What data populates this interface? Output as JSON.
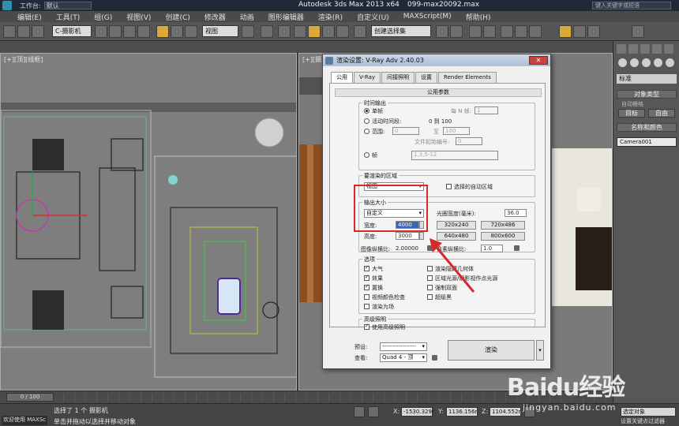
{
  "titlebar": {
    "workspace_label": "工作台:",
    "workspace_value": "默认",
    "app_title": "Autodesk 3ds Max  2013 x64",
    "file_name": "099-max20092.max",
    "search_placeholder": "键入关键字或短语"
  },
  "menu": [
    "编辑(E)",
    "工具(T)",
    "组(G)",
    "视图(V)",
    "创建(C)",
    "修改器",
    "动画",
    "图形编辑器",
    "渲染(R)",
    "自定义(U)",
    "MAXScript(M)",
    "帮助(H)"
  ],
  "toolbar": {
    "camera_dropdown": "C-摄影机",
    "view_dropdown": "视图",
    "selection_set": "创建选择集"
  },
  "viewports": {
    "left_label": "[+][顶][线框]",
    "right_label": "[+][摄影机][真实]"
  },
  "command_panel": {
    "standard": "标准",
    "object_type": "对象类型",
    "auto_grid": "自动栅格",
    "target_btn": "目标",
    "free_btn": "自由",
    "name_color": "名称和颜色",
    "camera_name": "Camera001"
  },
  "dialog": {
    "title": "渲染设置: V-Ray Adv 2.40.03",
    "close": "✕",
    "tabs": [
      "公用",
      "V-Ray",
      "间接照明",
      "设置",
      "Render Elements"
    ],
    "common_params": "公用参数",
    "time_output": {
      "title": "时间输出",
      "single": "单帧",
      "every_n_label": "每 N 帧:",
      "every_n_value": "1",
      "active_segment": "活动时间段:",
      "active_range": "0 到 100",
      "range": "范围:",
      "range_from": "0",
      "range_to_label": "至",
      "range_to": "100",
      "file_start_label": "文件起始编号:",
      "file_start": "0",
      "frames": "帧",
      "frames_value": "1,3,5-12"
    },
    "area": {
      "title": "要渲染的区域",
      "value": "视图",
      "auto_region": "选择的自动区域"
    },
    "output_size": {
      "title": "输出大小",
      "preset": "自定义",
      "aperture_label": "光圈宽度(毫米):",
      "aperture_value": "36.0",
      "width_label": "宽度:",
      "width_value": "4000",
      "height_label": "高度:",
      "height_value": "3000",
      "presets": [
        "320x240",
        "720x486",
        "640x480",
        "800x600"
      ],
      "image_aspect_label": "图像纵横比:",
      "image_aspect_value": "2.00000",
      "pixel_aspect_label": "像素纵横比:",
      "pixel_aspect_value": "1.0"
    },
    "options": {
      "title": "选项",
      "left": [
        {
          "label": "大气",
          "on": true
        },
        {
          "label": "效果",
          "on": true
        },
        {
          "label": "置换",
          "on": true
        },
        {
          "label": "视频颜色检查",
          "on": false
        },
        {
          "label": "渲染为场",
          "on": false
        }
      ],
      "right": [
        {
          "label": "渲染隐藏几何体",
          "on": false
        },
        {
          "label": "区域光源/阴影视作点光源",
          "on": false
        },
        {
          "label": "强制双面",
          "on": false
        },
        {
          "label": "超级黑",
          "on": false
        }
      ]
    },
    "advanced_lighting": {
      "title": "高级照明",
      "use": "使用高级照明"
    },
    "footer": {
      "preset_label": "预设:",
      "preset_value": "-----------------",
      "view_label": "查看:",
      "view_value": "Quad 4 - 顶",
      "render_button": "渲染"
    }
  },
  "timeline": {
    "frame": "0 / 100"
  },
  "statusbar": {
    "welcome": "欢迎使用 MAXSc",
    "line1": "选择了 1 个 摄影机",
    "line2": "单击并拖动以选择并移动对象",
    "x_label": "X:",
    "x_value": "-1530.329r",
    "y_label": "Y:",
    "y_value": "1136.156r",
    "z_label": "Z:",
    "z_value": "1104.552r",
    "filter": "选定对象",
    "setkey": "设置关键点过滤器"
  },
  "watermark": {
    "brand": "Baidu经验",
    "site": "jingyan.baidu.com"
  }
}
